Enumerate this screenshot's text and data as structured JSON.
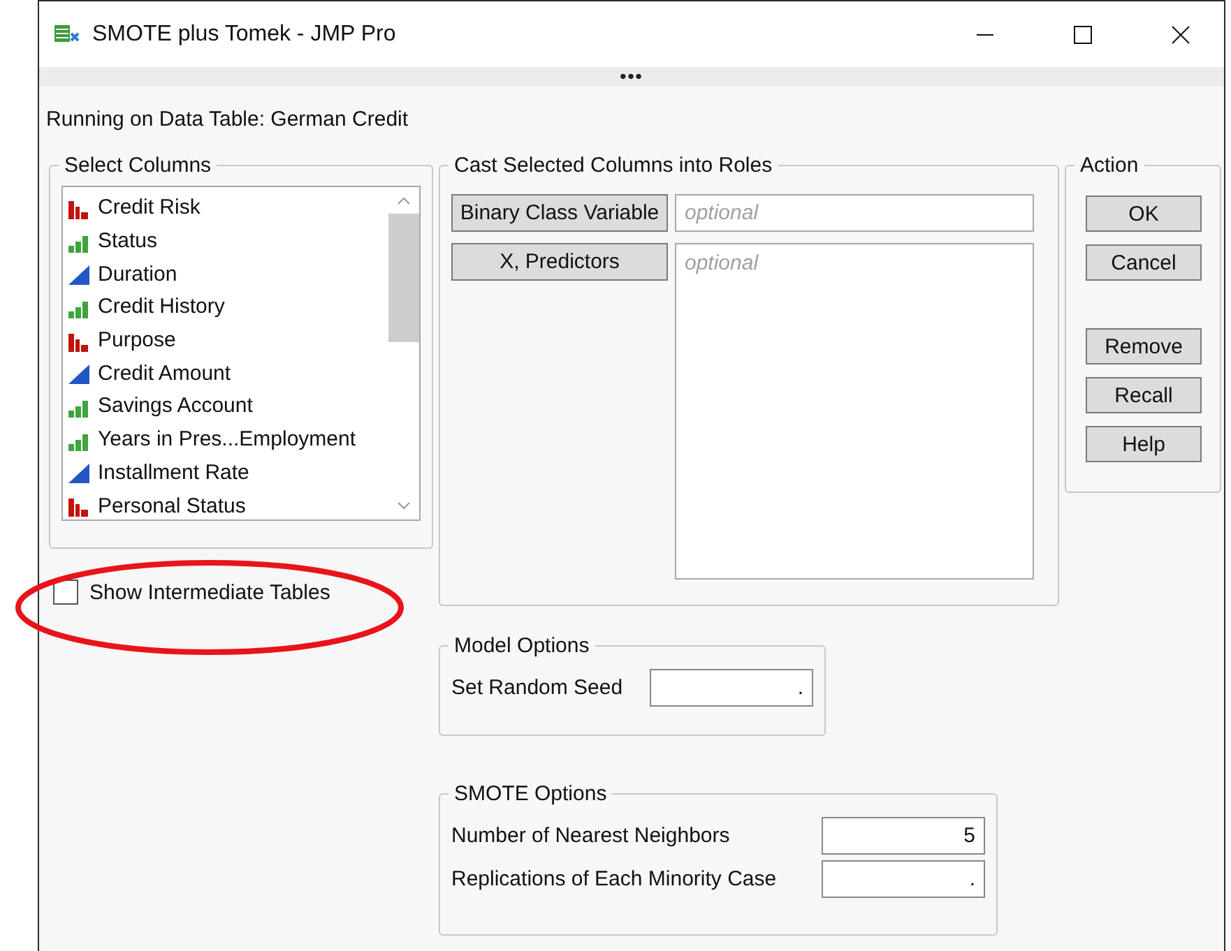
{
  "window": {
    "title": "SMOTE plus Tomek - JMP Pro",
    "drag_handle": "•••"
  },
  "running_label": "Running on Data Table: German Credit",
  "select_columns": {
    "title": "Select Columns",
    "columns": [
      {
        "name": "Credit Risk",
        "kind": "nominal"
      },
      {
        "name": "Status",
        "kind": "ordinal"
      },
      {
        "name": "Duration",
        "kind": "continuous"
      },
      {
        "name": "Credit History",
        "kind": "ordinal"
      },
      {
        "name": "Purpose",
        "kind": "nominal"
      },
      {
        "name": "Credit Amount",
        "kind": "continuous"
      },
      {
        "name": "Savings Account",
        "kind": "ordinal"
      },
      {
        "name": "Years in Pres...Employment",
        "kind": "ordinal"
      },
      {
        "name": "Installment Rate",
        "kind": "continuous"
      },
      {
        "name": "Personal Status",
        "kind": "nominal"
      }
    ]
  },
  "show_intermediate_tables": {
    "label": "Show Intermediate Tables",
    "checked": false,
    "highlighted": true
  },
  "cast_roles": {
    "title": "Cast Selected Columns into Roles",
    "roles": [
      {
        "button": "Binary Class Variable",
        "placeholder": "optional",
        "kind": "field"
      },
      {
        "button": "X, Predictors",
        "placeholder": "optional",
        "kind": "list"
      }
    ]
  },
  "action": {
    "title": "Action",
    "primary_buttons": [
      "OK",
      "Cancel"
    ],
    "secondary_buttons": [
      "Remove",
      "Recall",
      "Help"
    ]
  },
  "model_options": {
    "title": "Model Options",
    "fields": [
      {
        "label": "Set Random Seed",
        "value": "."
      }
    ]
  },
  "smote_options": {
    "title": "SMOTE Options",
    "fields": [
      {
        "label": "Number of Nearest Neighbors",
        "value": "5"
      },
      {
        "label": "Replications of Each Minority Case",
        "value": "."
      }
    ]
  }
}
